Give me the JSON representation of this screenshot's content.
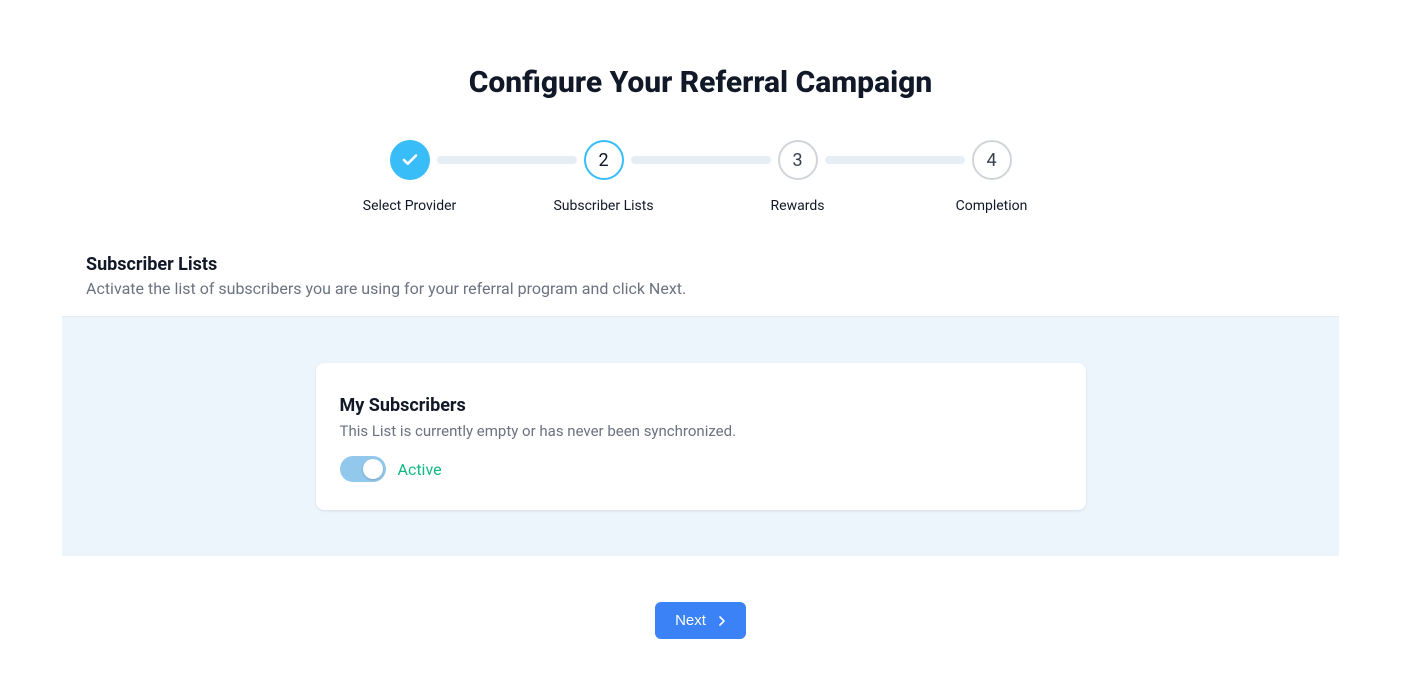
{
  "page": {
    "title": "Configure Your Referral Campaign"
  },
  "stepper": {
    "steps": [
      {
        "label": "Select Provider",
        "state": "completed"
      },
      {
        "label": "Subscriber Lists",
        "state": "active",
        "number": "2"
      },
      {
        "label": "Rewards",
        "state": "pending",
        "number": "3"
      },
      {
        "label": "Completion",
        "state": "pending",
        "number": "4"
      }
    ]
  },
  "section": {
    "title": "Subscriber Lists",
    "description": "Activate the list of subscribers you are using for your referral program and click Next."
  },
  "card": {
    "title": "My Subscribers",
    "description": "This List is currently empty or has never been synchronized.",
    "toggle_state": "on",
    "toggle_label": "Active"
  },
  "footer": {
    "next_label": "Next"
  }
}
